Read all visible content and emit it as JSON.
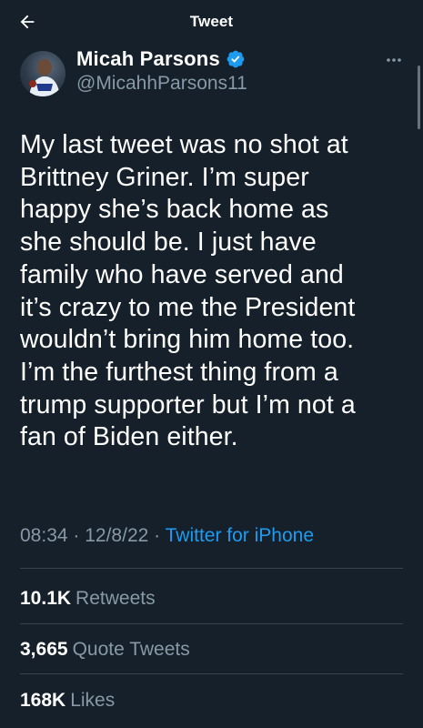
{
  "header": {
    "title": "Tweet",
    "back_icon": "arrow-left-icon"
  },
  "author": {
    "display_name": "Micah Parsons",
    "handle": "@MicahhParsons11",
    "verified": true,
    "verified_color": "#1d9bf0"
  },
  "tweet": {
    "text": "My last tweet was no shot at\nBrittney Griner. I’m super\nhappy she’s back home as\nshe should be. I just have\nfamily who have served and\nit’s crazy to me the President\nwouldn’t bring him home too.\nI’m the furthest thing from a\ntrump supporter but I’m not a\nfan of Biden either.",
    "time": "08:34",
    "date": "12/8/22",
    "source": "Twitter for iPhone"
  },
  "stats": {
    "retweets_count": "10.1K",
    "retweets_label": "Retweets",
    "quotes_count": "3,665",
    "quotes_label": "Quote Tweets",
    "likes_count": "168K",
    "likes_label": "Likes"
  },
  "colors": {
    "background": "#15202b",
    "secondary_text": "#8899a6",
    "accent": "#1d9bf0",
    "divider": "#38444d"
  }
}
